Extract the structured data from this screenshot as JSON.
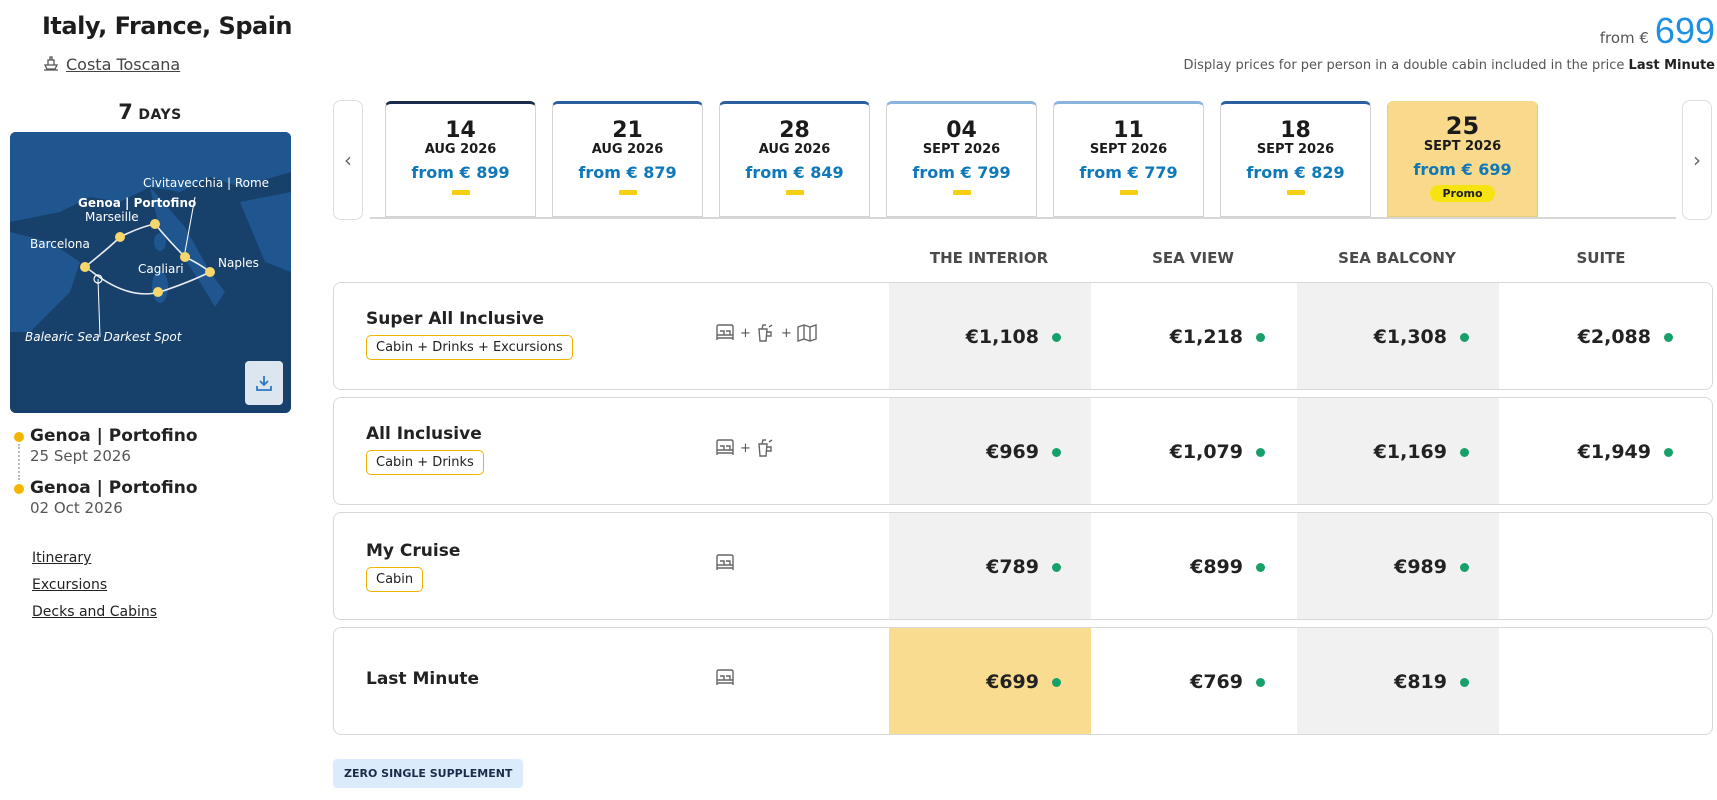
{
  "header": {
    "title": "Italy, France, Spain",
    "ship": "Costa Toscana",
    "price_from": "from €",
    "price_value": "699",
    "price_note": "Display prices for per person in a double cabin included in the price",
    "price_note_bold": "Last Minute"
  },
  "duration": {
    "number": "7",
    "unit": "DAYS"
  },
  "map": {
    "labels": {
      "civitavecchia": "Civitavecchia | Rome",
      "genoa": "Genoa | Portofino",
      "marseille": "Marseille",
      "barcelona": "Barcelona",
      "naples": "Naples",
      "cagliari": "Cagliari",
      "balearic": "Balearic Sea Darkest Spot"
    }
  },
  "itinerary": {
    "departure": {
      "port": "Genoa | Portofino",
      "date": "25 Sept 2026"
    },
    "arrival": {
      "port": "Genoa | Portofino",
      "date": "02 Oct 2026"
    }
  },
  "side_links": [
    "Itinerary",
    "Excursions",
    "Decks and Cabins"
  ],
  "carousel": {
    "prev": "‹",
    "next": "›",
    "dates": [
      {
        "day": "14",
        "month": "AUG 2026",
        "price": "from € 899"
      },
      {
        "day": "21",
        "month": "AUG 2026",
        "price": "from € 879"
      },
      {
        "day": "28",
        "month": "AUG 2026",
        "price": "from € 849"
      },
      {
        "day": "04",
        "month": "SEPT 2026",
        "price": "from € 799"
      },
      {
        "day": "11",
        "month": "SEPT 2026",
        "price": "from € 779"
      },
      {
        "day": "18",
        "month": "SEPT 2026",
        "price": "from € 829"
      },
      {
        "day": "25",
        "month": "SEPT 2026",
        "price": "from € 699",
        "badge": "Promo"
      }
    ]
  },
  "columns": [
    "THE INTERIOR",
    "SEA VIEW",
    "SEA BALCONY",
    "SUITE"
  ],
  "rows": [
    {
      "name": "Super All Inclusive",
      "tag": "Cabin + Drinks + Excursions",
      "prices": [
        "€1,108",
        "€1,218",
        "€1,308",
        "€2,088"
      ]
    },
    {
      "name": "All Inclusive",
      "tag": "Cabin + Drinks",
      "prices": [
        "€969",
        "€1,079",
        "€1,169",
        "€1,949"
      ]
    },
    {
      "name": "My Cruise",
      "tag": "Cabin",
      "prices": [
        "€789",
        "€899",
        "€989",
        ""
      ]
    },
    {
      "name": "Last Minute",
      "tag": "",
      "prices": [
        "€699",
        "€769",
        "€819",
        ""
      ]
    }
  ],
  "icons": {
    "plus": "+"
  },
  "badges": {
    "zero_single": "ZERO SINGLE SUPPLEMENT"
  },
  "colors": {
    "accent_blue": "#1e90e0",
    "price_blue": "#0e78b9",
    "selected_yellow": "#f9da8d",
    "availability_green": "#18a06a",
    "tag_border": "#f2b300"
  }
}
